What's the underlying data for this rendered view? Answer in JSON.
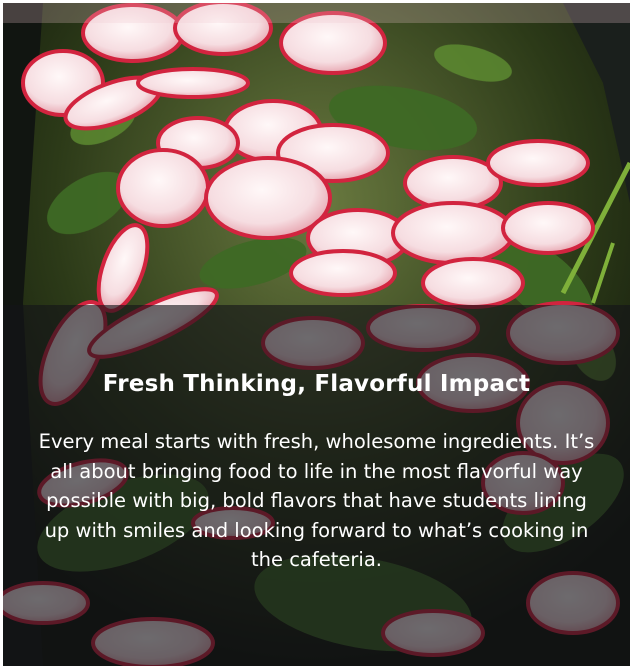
{
  "card": {
    "image_alt": "sliced radishes on fresh spinach leaves",
    "title": "Fresh Thinking, Flavorful Impact",
    "body": "Every meal starts with fresh, wholesome ingredients. It’s all about bringing food to life in the most flavorful way possible with big, bold flavors that have students lining up with smiles and looking forward to what’s cooking in the cafeteria."
  },
  "colors": {
    "overlay": "#141418",
    "text": "#ffffff",
    "radish_red": "#d2243f",
    "radish_flesh": "#fbeef0",
    "spinach_green": "#3f6a25"
  }
}
